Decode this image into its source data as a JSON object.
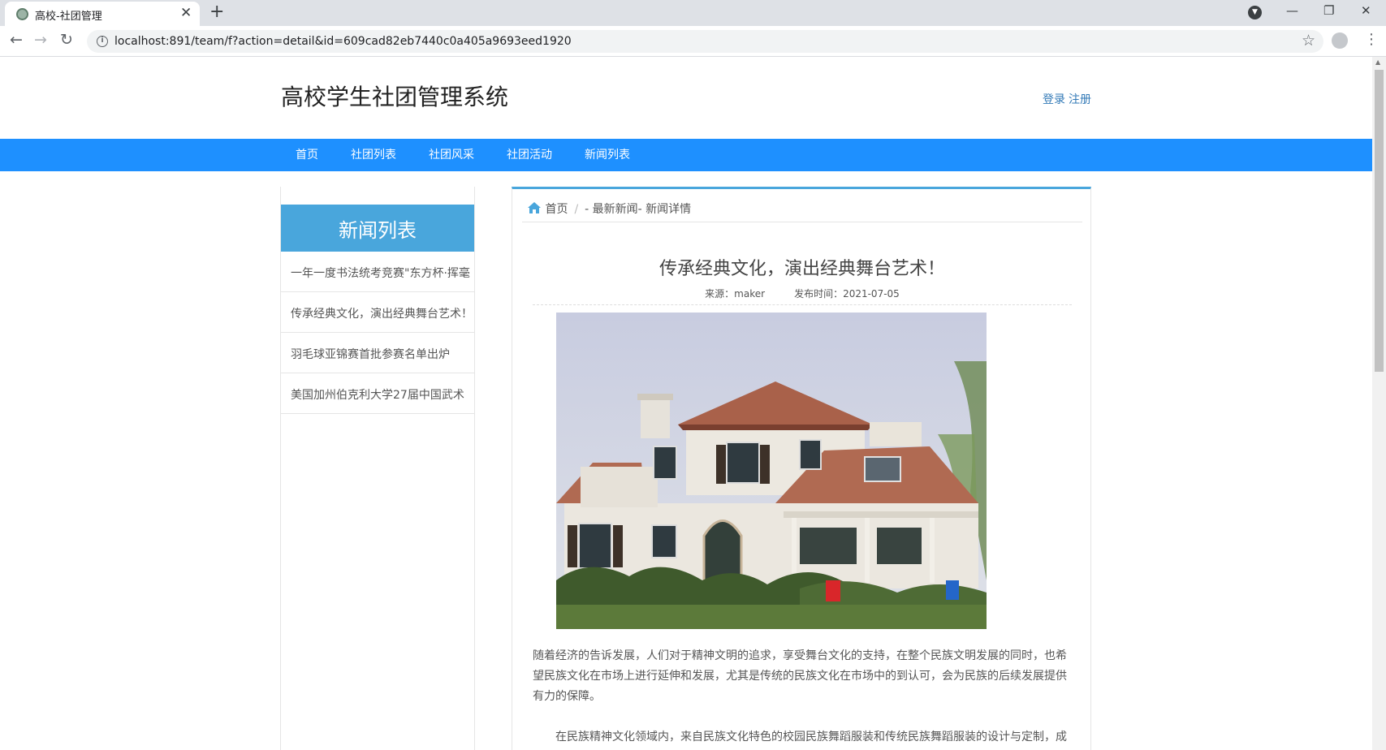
{
  "browser": {
    "tab_title": "高校-社团管理",
    "url": "localhost:891/team/f?action=detail&id=609cad82eb7440c0a405a9693eed1920"
  },
  "site": {
    "title": "高校学生社团管理系统",
    "login": "登录",
    "register": "注册"
  },
  "nav": [
    "首页",
    "社团列表",
    "社团风采",
    "社团活动",
    "新闻列表"
  ],
  "sidebar": {
    "heading": "新闻列表",
    "items": [
      "一年一度书法统考竞赛\"东方杯·挥毫",
      "传承经典文化，演出经典舞台艺术！",
      "羽毛球亚锦赛首批参赛名单出炉",
      "美国加州伯克利大学27届中国武术"
    ]
  },
  "breadcrumb": {
    "home": "首页",
    "sep": "/",
    "rest": "- 最新新闻- 新闻详情"
  },
  "article": {
    "title": "传承经典文化，演出经典舞台艺术！",
    "source": "来源：maker",
    "published": "发布时间：2021-07-05",
    "para1": "随着经济的告诉发展，人们对于精神文明的追求，享受舞台文化的支持，在整个民族文明发展的同时，也希望民族文化在市场上进行延伸和发展，尤其是传统的民族文化在市场中的到认可，会为民族的后续发展提供有力的保障。",
    "para2": "在民族精神文化领域内，来自民族文化特色的校园民族舞蹈服装和传统民族舞蹈服装的设计与定制，成为了诸多民族文化宣传和推广的主要精神源，他们不仅能够带给人们精神领域的冲击，还能够带给对于民族"
  }
}
